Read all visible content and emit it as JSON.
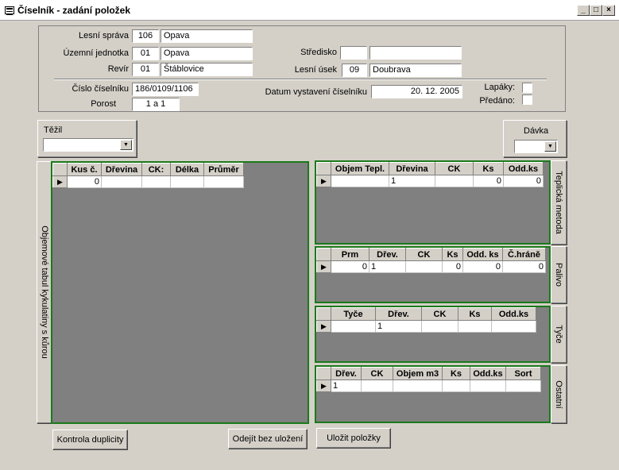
{
  "window": {
    "title": "Číselník - zadání položek",
    "minimize": "_",
    "maximize": "□",
    "close": "×"
  },
  "header": {
    "lesni_sprava": {
      "label": "Lesní správa",
      "code": "106",
      "name": "Opava"
    },
    "uzemni_jednotka": {
      "label": "Územní jednotka",
      "code": "01",
      "name": "Opava"
    },
    "revir": {
      "label": "Revír",
      "code": "01",
      "name": "Štáblovice"
    },
    "stredisko": {
      "label": "Středisko",
      "code": "",
      "name": ""
    },
    "lesni_usek": {
      "label": "Lesní úsek",
      "code": "09",
      "name": "Doubrava"
    },
    "cislo_ciselniku": {
      "label": "Číslo číselníku",
      "value": "186/0109/1106"
    },
    "porost": {
      "label": "Porost",
      "value": "1 a 1"
    },
    "datum": {
      "label": "Datum vystavení číselníku",
      "value": "20. 12. 2005"
    },
    "lapaky": {
      "label": "Lapáky:"
    },
    "predano": {
      "label": "Předáno:"
    }
  },
  "tezil": {
    "label": "Těžil",
    "value": ""
  },
  "davka": {
    "label": "Dávka",
    "value": ""
  },
  "left_panel": {
    "side_label": "Objemové tabul kykulatiny  s kůrou",
    "columns": [
      "Kus č.",
      "Dřevina",
      "CK:",
      "Délka",
      "Průměr"
    ],
    "row": [
      "0",
      "",
      "",
      "",
      ""
    ]
  },
  "teplicka": {
    "side_label": "Teplická metoda",
    "columns": [
      "Objem Tepl.",
      "Dřevina",
      "CK",
      "Ks",
      "Odd.ks"
    ],
    "row": [
      "",
      "1",
      "",
      "0",
      "0"
    ]
  },
  "palivo": {
    "side_label": "Palivo",
    "columns": [
      "Prm",
      "Dřev.",
      "CK",
      "Ks",
      "Odd. ks",
      "Č.hráně"
    ],
    "row": [
      "0",
      "1",
      "",
      "0",
      "0",
      "0"
    ]
  },
  "tyce": {
    "side_label": "Tyče",
    "columns": [
      "Tyče",
      "Dřev.",
      "CK",
      "Ks",
      "Odd.ks"
    ],
    "row": [
      "",
      "1",
      "",
      "",
      ""
    ]
  },
  "ostatni": {
    "side_label": "Ostatní",
    "columns": [
      "Dřev.",
      "CK",
      "Objem m3",
      "Ks",
      "Odd.ks",
      "Sort"
    ],
    "row": [
      "1",
      "",
      "",
      "",
      "",
      ""
    ]
  },
  "buttons": {
    "kontrola": "Kontrola duplicity",
    "odejit": "Odejít bez uložení",
    "ulozit": "Uložit položky"
  }
}
